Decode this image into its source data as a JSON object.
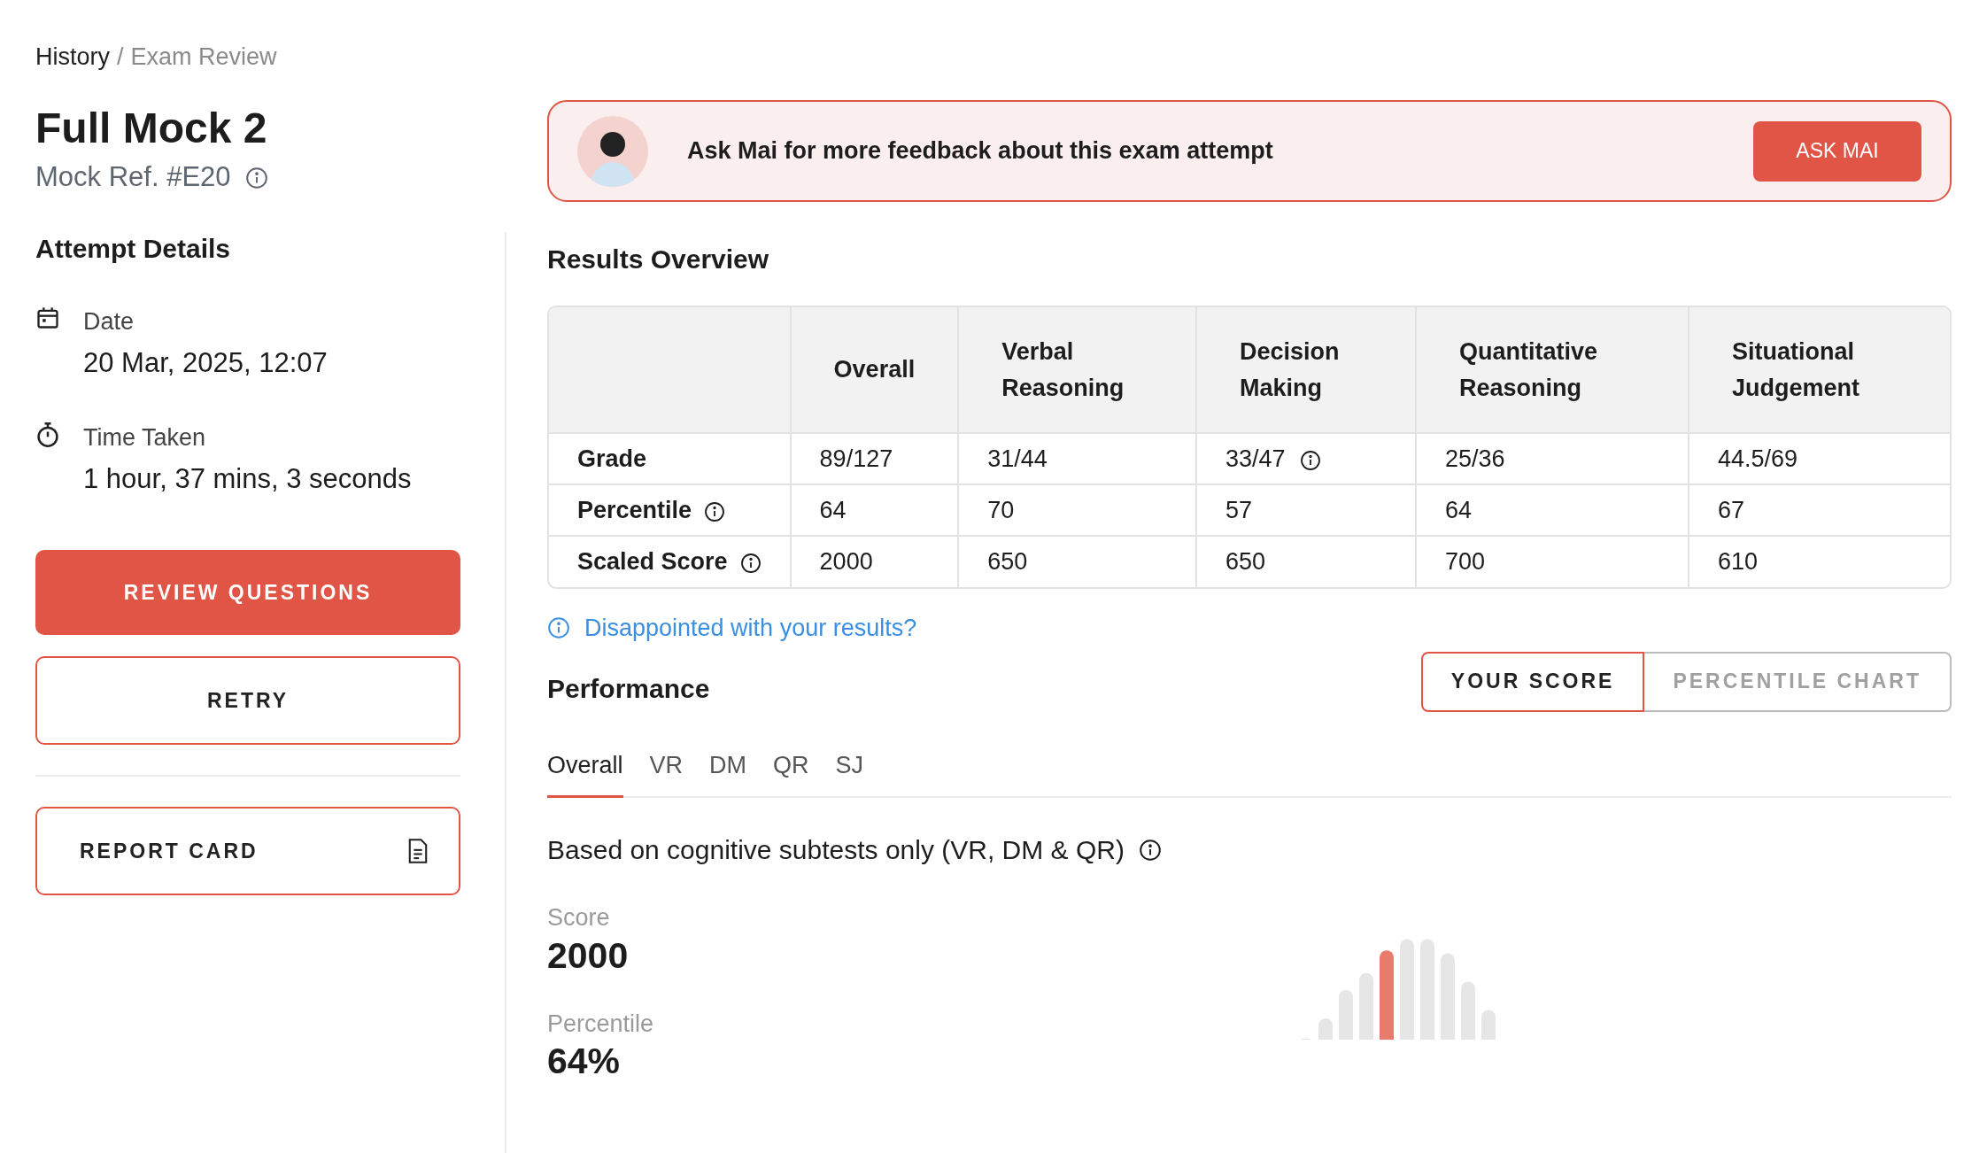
{
  "breadcrumb": [
    {
      "label": "History",
      "current": false
    },
    {
      "label": "Exam Review",
      "current": true
    }
  ],
  "breadcrumb_separator": "/",
  "title": "Full Mock 2",
  "reference": "Mock Ref. #E20",
  "attempt_details": {
    "heading": "Attempt Details",
    "items": [
      {
        "kind": "date",
        "label": "Date",
        "value": "20 Mar, 2025, 12:07"
      },
      {
        "kind": "timer",
        "label": "Time Taken",
        "value": "1 hour, 37 mins, 3 seconds"
      }
    ]
  },
  "actions": [
    {
      "kind": "primary",
      "label": "REVIEW QUESTIONS"
    },
    {
      "kind": "outline",
      "label": "RETRY"
    },
    {
      "kind": "divider"
    },
    {
      "kind": "document",
      "label": "REPORT CARD"
    }
  ],
  "banner": {
    "message": "Ask Mai for more feedback about this exam attempt",
    "button": "ASK MAI"
  },
  "results": {
    "heading": "Results Overview",
    "columns": [
      "Overall",
      "Verbal Reasoning",
      "Decision Making",
      "Quantitative Reasoning",
      "Situational Judgement"
    ],
    "rows": [
      {
        "label": "Grade",
        "info": false,
        "cells": [
          {
            "text": "89/127",
            "info": false
          },
          {
            "text": "31/44",
            "info": false
          },
          {
            "text": "33/47",
            "info": true
          },
          {
            "text": "25/36",
            "info": false
          },
          {
            "text": "44.5/69",
            "info": false
          }
        ]
      },
      {
        "label": "Percentile",
        "info": true,
        "cells": [
          {
            "text": "64",
            "info": false
          },
          {
            "text": "70",
            "info": false
          },
          {
            "text": "57",
            "info": false
          },
          {
            "text": "64",
            "info": false
          },
          {
            "text": "67",
            "info": false
          }
        ]
      },
      {
        "label": "Scaled Score",
        "info": true,
        "cells": [
          {
            "text": "2000",
            "info": false
          },
          {
            "text": "650",
            "info": false
          },
          {
            "text": "650",
            "info": false
          },
          {
            "text": "700",
            "info": false
          },
          {
            "text": "610",
            "info": false
          }
        ]
      }
    ]
  },
  "help_link": "Disappointed with your results?",
  "performance": {
    "heading": "Performance",
    "views": [
      {
        "label": "YOUR SCORE",
        "selected": true
      },
      {
        "label": "PERCENTILE CHART",
        "selected": false
      }
    ],
    "tabs": [
      {
        "label": "Overall",
        "selected": true
      },
      {
        "label": "VR",
        "selected": false
      },
      {
        "label": "DM",
        "selected": false
      },
      {
        "label": "QR",
        "selected": false
      },
      {
        "label": "SJ",
        "selected": false
      }
    ],
    "note": "Based on cognitive subtests only (VR, DM & QR)",
    "stats": [
      {
        "label": "Score",
        "value": "2000"
      },
      {
        "label": "Percentile",
        "value": "64%"
      }
    ]
  }
}
